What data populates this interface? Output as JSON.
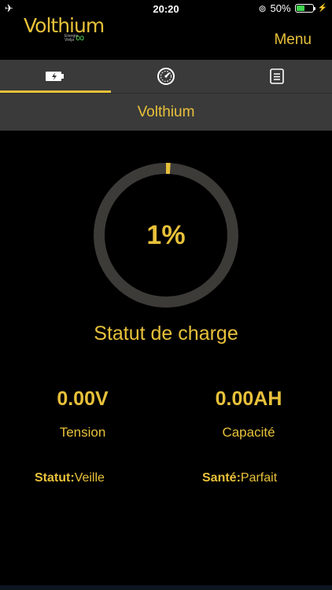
{
  "statusbar": {
    "time": "20:20",
    "battery_percent": "50%",
    "battery_level": 0.5
  },
  "header": {
    "logo_text": "Volthium",
    "logo_sub_1": "Energie",
    "logo_sub_2": "Vielja",
    "menu_label": "Menu"
  },
  "tabs": [
    {
      "icon": "battery-icon",
      "active": true
    },
    {
      "icon": "gauge-icon",
      "active": false
    },
    {
      "icon": "document-icon",
      "active": false
    }
  ],
  "device_name": "Volthium",
  "charge": {
    "percent_text": "1%",
    "percent_value": 1,
    "label": "Statut de charge"
  },
  "metrics": {
    "voltage": {
      "value": "0.00V",
      "label": "Tension"
    },
    "capacity": {
      "value": "0.00AH",
      "label": "Capacité"
    }
  },
  "status": {
    "statut_key": "Statut:",
    "statut_val": "Veille",
    "sante_key": "Santé:",
    "sante_val": "Parfait"
  },
  "colors": {
    "accent": "#e8c13a",
    "bar_bg": "#3a3a3a",
    "ring_track": "#3d3b38",
    "battery_green": "#3ed64e"
  }
}
